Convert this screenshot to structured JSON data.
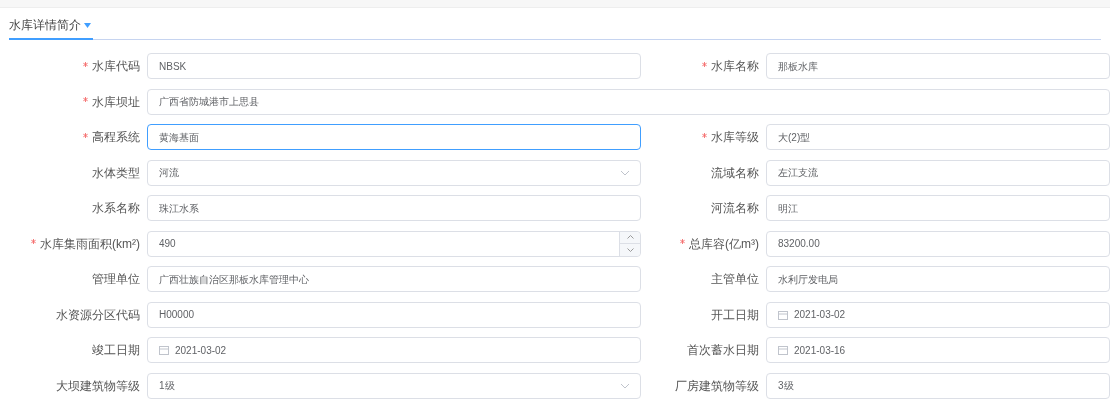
{
  "section": {
    "title": "水库详情简介",
    "expanded": true
  },
  "rows": [
    {
      "fields": [
        {
          "label": "水库代码",
          "required": true,
          "kind": "text",
          "value": "NBSK",
          "focused": false
        },
        {
          "label": "水库名称",
          "required": true,
          "kind": "text",
          "value": "那板水库",
          "focused": false
        }
      ]
    },
    {
      "fields": [
        {
          "label": "水库坝址",
          "required": true,
          "kind": "text",
          "value": "广西省防城港市上思县",
          "focused": false
        }
      ]
    },
    {
      "fields": [
        {
          "label": "高程系统",
          "required": true,
          "kind": "text",
          "value": "黄海基面",
          "focused": true
        },
        {
          "label": "水库等级",
          "required": true,
          "kind": "text",
          "value": "大(2)型",
          "focused": false
        }
      ]
    },
    {
      "fields": [
        {
          "label": "水体类型",
          "required": false,
          "kind": "select",
          "value": "河流",
          "focused": false
        },
        {
          "label": "流域名称",
          "required": false,
          "kind": "text",
          "value": "左江支流",
          "focused": false
        }
      ]
    },
    {
      "fields": [
        {
          "label": "水系名称",
          "required": false,
          "kind": "text",
          "value": "珠江水系",
          "focused": false
        },
        {
          "label": "河流名称",
          "required": false,
          "kind": "text",
          "value": "明江",
          "focused": false
        }
      ]
    },
    {
      "fields": [
        {
          "label": "水库集雨面积(km²)",
          "required": true,
          "kind": "number",
          "value": "490",
          "focused": false
        },
        {
          "label": "总库容(亿m³)",
          "required": true,
          "kind": "text",
          "value": "83200.00",
          "focused": false
        }
      ]
    },
    {
      "fields": [
        {
          "label": "管理单位",
          "required": false,
          "kind": "text",
          "value": "广西壮族自治区那板水库管理中心",
          "focused": false
        },
        {
          "label": "主管单位",
          "required": false,
          "kind": "text",
          "value": "水利厅发电局",
          "focused": false
        }
      ]
    },
    {
      "fields": [
        {
          "label": "水资源分区代码",
          "required": false,
          "kind": "text",
          "value": "H00000",
          "focused": false
        },
        {
          "label": "开工日期",
          "required": false,
          "kind": "date",
          "value": "2021-03-02",
          "focused": false
        }
      ]
    },
    {
      "fields": [
        {
          "label": "竣工日期",
          "required": false,
          "kind": "date",
          "value": "2021-03-02",
          "focused": false
        },
        {
          "label": "首次蓄水日期",
          "required": false,
          "kind": "date",
          "value": "2021-03-16",
          "focused": false
        }
      ]
    },
    {
      "fields": [
        {
          "label": "大坝建筑物等级",
          "required": false,
          "kind": "select",
          "value": "1级",
          "focused": false
        },
        {
          "label": "厂房建筑物等级",
          "required": false,
          "kind": "text",
          "value": "3级",
          "focused": false
        }
      ]
    }
  ]
}
